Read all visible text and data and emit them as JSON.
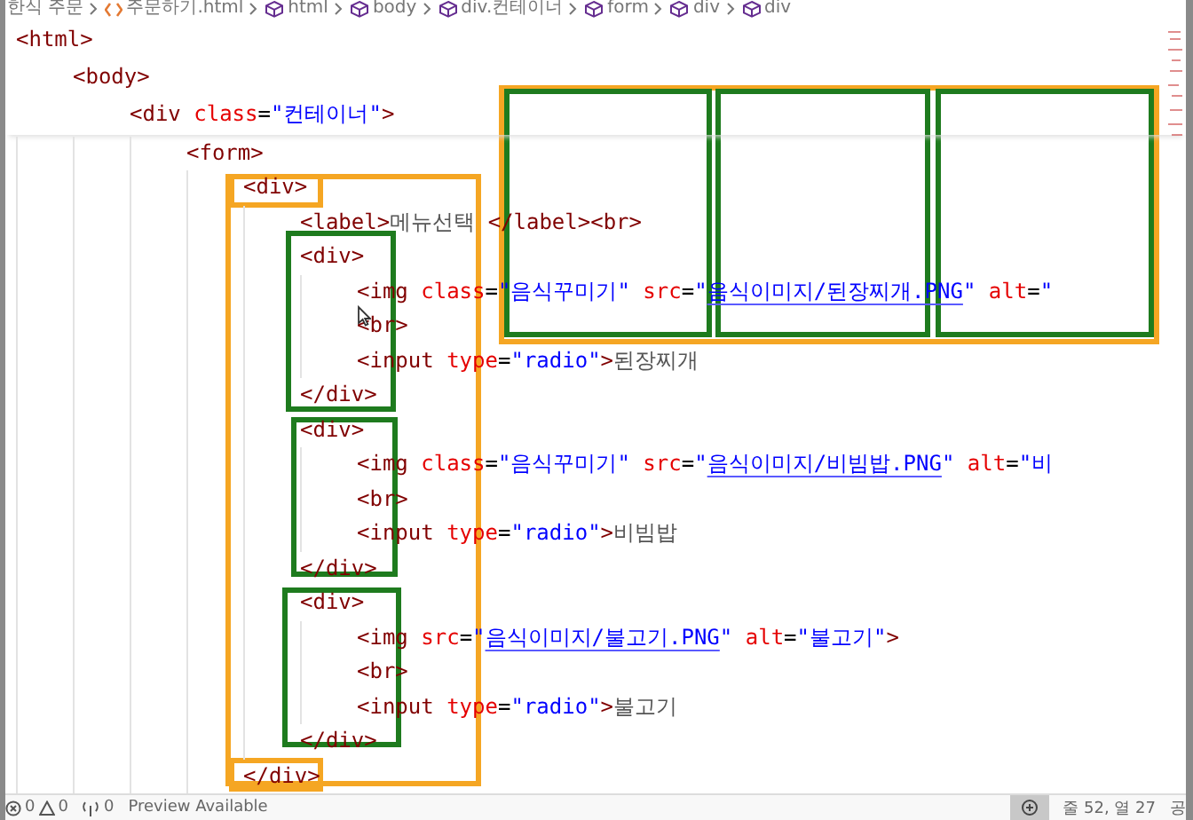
{
  "breadcrumb": [
    {
      "kind": "folder",
      "text": "한식 주문"
    },
    {
      "kind": "file",
      "text": "주문하기.html"
    },
    {
      "kind": "symbol",
      "text": "html"
    },
    {
      "kind": "symbol",
      "text": "body"
    },
    {
      "kind": "symbol",
      "text": "div.컨테이너"
    },
    {
      "kind": "symbol",
      "text": "form"
    },
    {
      "kind": "symbol",
      "text": "div"
    },
    {
      "kind": "symbol",
      "text": "div"
    }
  ],
  "sticky_scroll": [
    {
      "tokens": [
        {
          "kind": "tag",
          "text": "<html>"
        }
      ]
    },
    {
      "tokens": [
        {
          "kind": "tag",
          "text": "<body>"
        }
      ]
    },
    {
      "tokens": [
        {
          "kind": "tag",
          "text": "<div"
        },
        {
          "kind": "attr",
          "text": " class"
        },
        {
          "kind": "punct",
          "text": "="
        },
        {
          "kind": "str",
          "text": "\"컨테이너\""
        },
        {
          "kind": "tag",
          "text": ">"
        }
      ]
    }
  ],
  "code_lines": [
    {
      "tokens": [
        {
          "kind": "tag",
          "text": "<form>"
        }
      ],
      "children": [
        {
          "tokens": [
            {
              "kind": "tag",
              "text": "<div>"
            }
          ],
          "children": [
            {
              "tokens": [
                {
                  "kind": "tag",
                  "text": "<label>"
                },
                {
                  "kind": "text",
                  "text": "메뉴선택 "
                },
                {
                  "kind": "tag",
                  "text": "</label><br>"
                }
              ]
            },
            {
              "tokens": [
                {
                  "kind": "tag",
                  "text": "<div>"
                }
              ],
              "children": [
                {
                  "tokens": [
                    {
                      "kind": "tag",
                      "text": "<img"
                    },
                    {
                      "kind": "attr",
                      "text": " class"
                    },
                    {
                      "kind": "punct",
                      "text": "="
                    },
                    {
                      "kind": "str",
                      "text": "\"음식꾸미기\""
                    },
                    {
                      "kind": "attr",
                      "text": " src"
                    },
                    {
                      "kind": "punct",
                      "text": "="
                    },
                    {
                      "kind": "str",
                      "text": "\""
                    },
                    {
                      "kind": "link",
                      "text": "음식이미지/된장찌개.PNG"
                    },
                    {
                      "kind": "str",
                      "text": "\""
                    },
                    {
                      "kind": "attr",
                      "text": " alt"
                    },
                    {
                      "kind": "punct",
                      "text": "="
                    },
                    {
                      "kind": "str",
                      "text": "\""
                    }
                  ]
                },
                {
                  "tokens": [
                    {
                      "kind": "tag",
                      "text": "<br>"
                    }
                  ]
                },
                {
                  "tokens": [
                    {
                      "kind": "tag",
                      "text": "<input"
                    },
                    {
                      "kind": "attr",
                      "text": " type"
                    },
                    {
                      "kind": "punct",
                      "text": "="
                    },
                    {
                      "kind": "str",
                      "text": "\"radio\""
                    },
                    {
                      "kind": "tag",
                      "text": ">"
                    },
                    {
                      "kind": "text",
                      "text": "된장찌개"
                    }
                  ]
                }
              ]
            },
            {
              "tokens": [
                {
                  "kind": "tag",
                  "text": "</div>"
                }
              ]
            },
            {
              "tokens": [
                {
                  "kind": "tag",
                  "text": "<div>"
                }
              ],
              "children": [
                {
                  "tokens": [
                    {
                      "kind": "tag",
                      "text": "<img"
                    },
                    {
                      "kind": "attr",
                      "text": " class"
                    },
                    {
                      "kind": "punct",
                      "text": "="
                    },
                    {
                      "kind": "str",
                      "text": "\"음식꾸미기\""
                    },
                    {
                      "kind": "attr",
                      "text": " src"
                    },
                    {
                      "kind": "punct",
                      "text": "="
                    },
                    {
                      "kind": "str",
                      "text": "\""
                    },
                    {
                      "kind": "link",
                      "text": "음식이미지/비빔밥.PNG"
                    },
                    {
                      "kind": "str",
                      "text": "\""
                    },
                    {
                      "kind": "attr",
                      "text": " alt"
                    },
                    {
                      "kind": "punct",
                      "text": "="
                    },
                    {
                      "kind": "str",
                      "text": "\"비"
                    }
                  ]
                },
                {
                  "tokens": [
                    {
                      "kind": "tag",
                      "text": "<br>"
                    }
                  ]
                },
                {
                  "tokens": [
                    {
                      "kind": "tag",
                      "text": "<input"
                    },
                    {
                      "kind": "attr",
                      "text": " type"
                    },
                    {
                      "kind": "punct",
                      "text": "="
                    },
                    {
                      "kind": "str",
                      "text": "\"radio\""
                    },
                    {
                      "kind": "tag",
                      "text": ">"
                    },
                    {
                      "kind": "text",
                      "text": "비빔밥"
                    }
                  ]
                }
              ]
            },
            {
              "tokens": [
                {
                  "kind": "tag",
                  "text": "</div>"
                }
              ]
            },
            {
              "tokens": [
                {
                  "kind": "tag",
                  "text": "<div>"
                }
              ],
              "children": [
                {
                  "tokens": [
                    {
                      "kind": "tag",
                      "text": "<img"
                    },
                    {
                      "kind": "attr",
                      "text": " src"
                    },
                    {
                      "kind": "punct",
                      "text": "="
                    },
                    {
                      "kind": "str",
                      "text": "\""
                    },
                    {
                      "kind": "link",
                      "text": "음식이미지/불고기.PNG"
                    },
                    {
                      "kind": "str",
                      "text": "\""
                    },
                    {
                      "kind": "attr",
                      "text": " alt"
                    },
                    {
                      "kind": "punct",
                      "text": "="
                    },
                    {
                      "kind": "str",
                      "text": "\"불고기\""
                    },
                    {
                      "kind": "tag",
                      "text": ">"
                    }
                  ]
                },
                {
                  "tokens": [
                    {
                      "kind": "tag",
                      "text": "<br>"
                    }
                  ]
                },
                {
                  "tokens": [
                    {
                      "kind": "tag",
                      "text": "<input"
                    },
                    {
                      "kind": "attr",
                      "text": " type"
                    },
                    {
                      "kind": "punct",
                      "text": "="
                    },
                    {
                      "kind": "str",
                      "text": "\"radio\""
                    },
                    {
                      "kind": "tag",
                      "text": ">"
                    },
                    {
                      "kind": "text",
                      "text": "불고기"
                    }
                  ]
                }
              ]
            },
            {
              "tokens": [
                {
                  "kind": "tag",
                  "text": "</div>"
                }
              ]
            }
          ]
        },
        {
          "tokens": [
            {
              "kind": "tag",
              "text": "</div>"
            }
          ]
        }
      ]
    }
  ],
  "highlight_boxes": [
    {
      "color": "#f5a623"
    },
    {
      "color": "#1e7b1e"
    },
    {
      "color": "#1e7b1e"
    },
    {
      "color": "#1e7b1e"
    },
    {
      "color": "#f5a623"
    },
    {
      "color": "#f5a623"
    },
    {
      "color": "#f5a623"
    },
    {
      "color": "#1e7b1e"
    },
    {
      "color": "#1e7b1e"
    },
    {
      "color": "#1e7b1e"
    }
  ],
  "status_bar": {
    "errors": "0",
    "warnings": "0",
    "ports": "0",
    "message": "Preview Available",
    "position": "줄 52, 열 27",
    "extra": "공"
  }
}
